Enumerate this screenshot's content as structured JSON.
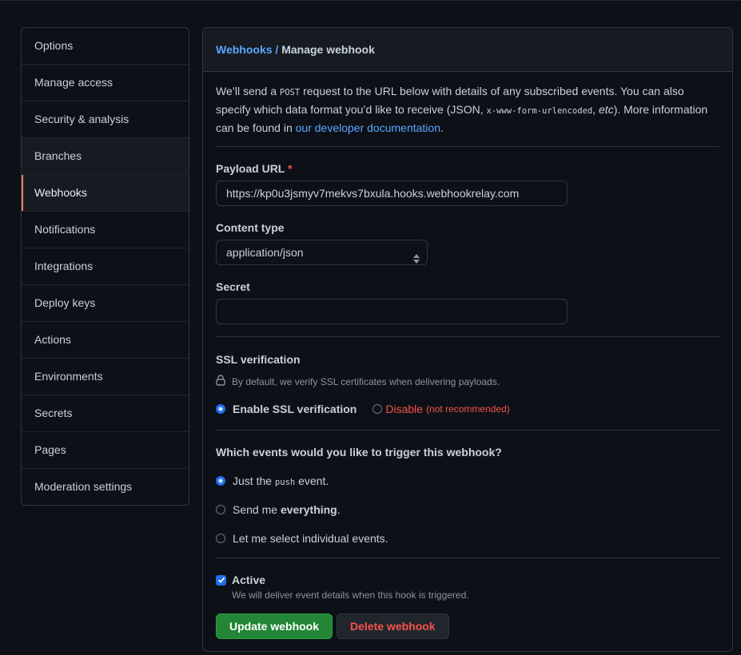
{
  "sidebar": {
    "items": [
      {
        "label": "Options"
      },
      {
        "label": "Manage access"
      },
      {
        "label": "Security & analysis"
      },
      {
        "label": "Branches"
      },
      {
        "label": "Webhooks"
      },
      {
        "label": "Notifications"
      },
      {
        "label": "Integrations"
      },
      {
        "label": "Deploy keys"
      },
      {
        "label": "Actions"
      },
      {
        "label": "Environments"
      },
      {
        "label": "Secrets"
      },
      {
        "label": "Pages"
      },
      {
        "label": "Moderation settings"
      }
    ],
    "selected": "Webhooks"
  },
  "header": {
    "crumb_link": "Webhooks",
    "crumb_sep": "/",
    "crumb_current": "Manage webhook"
  },
  "intro": {
    "t1": "We’ll send a ",
    "code1": "POST",
    "t2": " request to the URL below with details of any subscribed events. You can also specify which data format you’d like to receive (JSON, ",
    "code2": "x-www-form-urlencoded",
    "t3": ", ",
    "t3_em": "etc",
    "t4": "). More information can be found in ",
    "link": "our developer documentation",
    "t5": "."
  },
  "payload_url": {
    "label": "Payload URL",
    "required_mark": "*",
    "value": "https://kp0u3jsmyv7mekvs7bxula.hooks.webhookrelay.com"
  },
  "content_type": {
    "label": "Content type",
    "value": "application/json"
  },
  "secret": {
    "label": "Secret",
    "value": ""
  },
  "ssl": {
    "heading": "SSL verification",
    "note": "By default, we verify SSL certificates when delivering payloads.",
    "enable_label": "Enable SSL verification",
    "disable_label": "Disable",
    "disable_note": "(not recommended)"
  },
  "events": {
    "heading": "Which events would you like to trigger this webhook?",
    "opt1_a": "Just the ",
    "opt1_code": "push",
    "opt1_b": " event.",
    "opt2_a": "Send me ",
    "opt2_b": "everything",
    "opt2_c": ".",
    "opt3": "Let me select individual events."
  },
  "active": {
    "label": "Active",
    "note": "We will deliver event details when this hook is triggered.",
    "checked": true
  },
  "buttons": {
    "update": "Update webhook",
    "delete": "Delete webhook"
  },
  "colors": {
    "accent": "#58a6ff",
    "primary_button": "#238636",
    "danger": "#f85149",
    "selected_marker": "#f78166"
  }
}
